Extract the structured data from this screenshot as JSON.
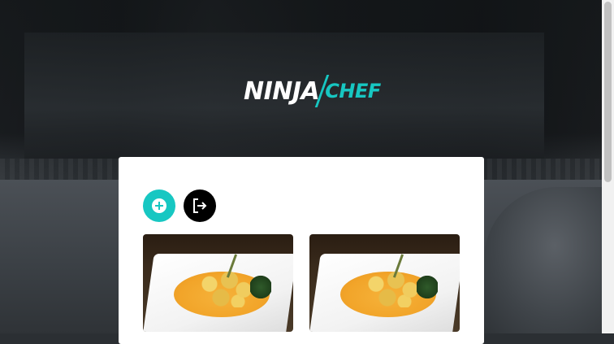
{
  "brand": {
    "logo_part1": "NINJA",
    "logo_part2": "CHEF",
    "accent_color": "#17c7c2"
  },
  "toolbar": {
    "add_icon": "plus-circle-icon",
    "logout_icon": "logout-icon"
  },
  "recipes": [
    {
      "image": "dish-photo"
    },
    {
      "image": "dish-photo"
    }
  ]
}
